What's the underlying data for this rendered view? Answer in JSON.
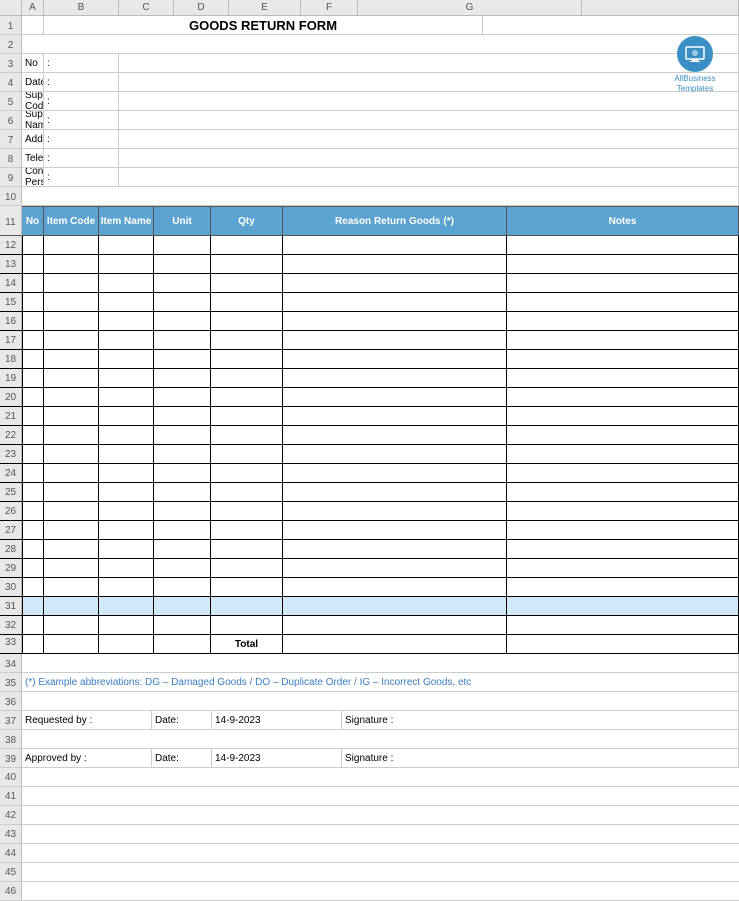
{
  "title": "GOODS RETURN FORM",
  "logo": {
    "text_line1": "AllBusiness",
    "text_line2": "Templates"
  },
  "form_fields": [
    {
      "label": "No",
      "colon": ":"
    },
    {
      "label": "Date",
      "colon": ":"
    },
    {
      "label": "Supplier Code",
      "colon": ":"
    },
    {
      "label": "Supplier Name",
      "colon": ":"
    },
    {
      "label": "Address",
      "colon": ":"
    },
    {
      "label": "Telephone",
      "colon": ":"
    },
    {
      "label": "Contact Person",
      "colon": ":"
    }
  ],
  "table_headers": {
    "no": "No",
    "item_code": "Item Code",
    "item_name": "Item Name",
    "unit": "Unit",
    "qty": "Qty",
    "reason": "Reason Return Goods (*)",
    "notes": "Notes"
  },
  "table_rows": 21,
  "total_label": "Total",
  "footnote": "(*) Example abbreviations: DG – Damaged Goods / DO – Duplicate Order / IG – Incorrect Goods, etc",
  "signatures": [
    {
      "requested_by_label": "Requested by :",
      "date_label": "Date:",
      "date_value": "14-9-2023",
      "signature_label": "Signature :"
    },
    {
      "approved_by_label": "Approved by :",
      "date_label": "Date:",
      "date_value": "14-9-2023",
      "signature_label": "Signature :"
    }
  ],
  "columns": {
    "A": "A",
    "B": "B",
    "C": "C",
    "D": "D",
    "E": "E",
    "F": "F",
    "G": "G"
  },
  "row_numbers": [
    1,
    2,
    3,
    4,
    5,
    6,
    7,
    8,
    9,
    10,
    11,
    12,
    13,
    14,
    15,
    16,
    17,
    18,
    19,
    20,
    21,
    22,
    23,
    24,
    25,
    26,
    27,
    28,
    29,
    30,
    31,
    32,
    33,
    34,
    35,
    36,
    37,
    38,
    39,
    40,
    41,
    42,
    43,
    44,
    45,
    46
  ]
}
